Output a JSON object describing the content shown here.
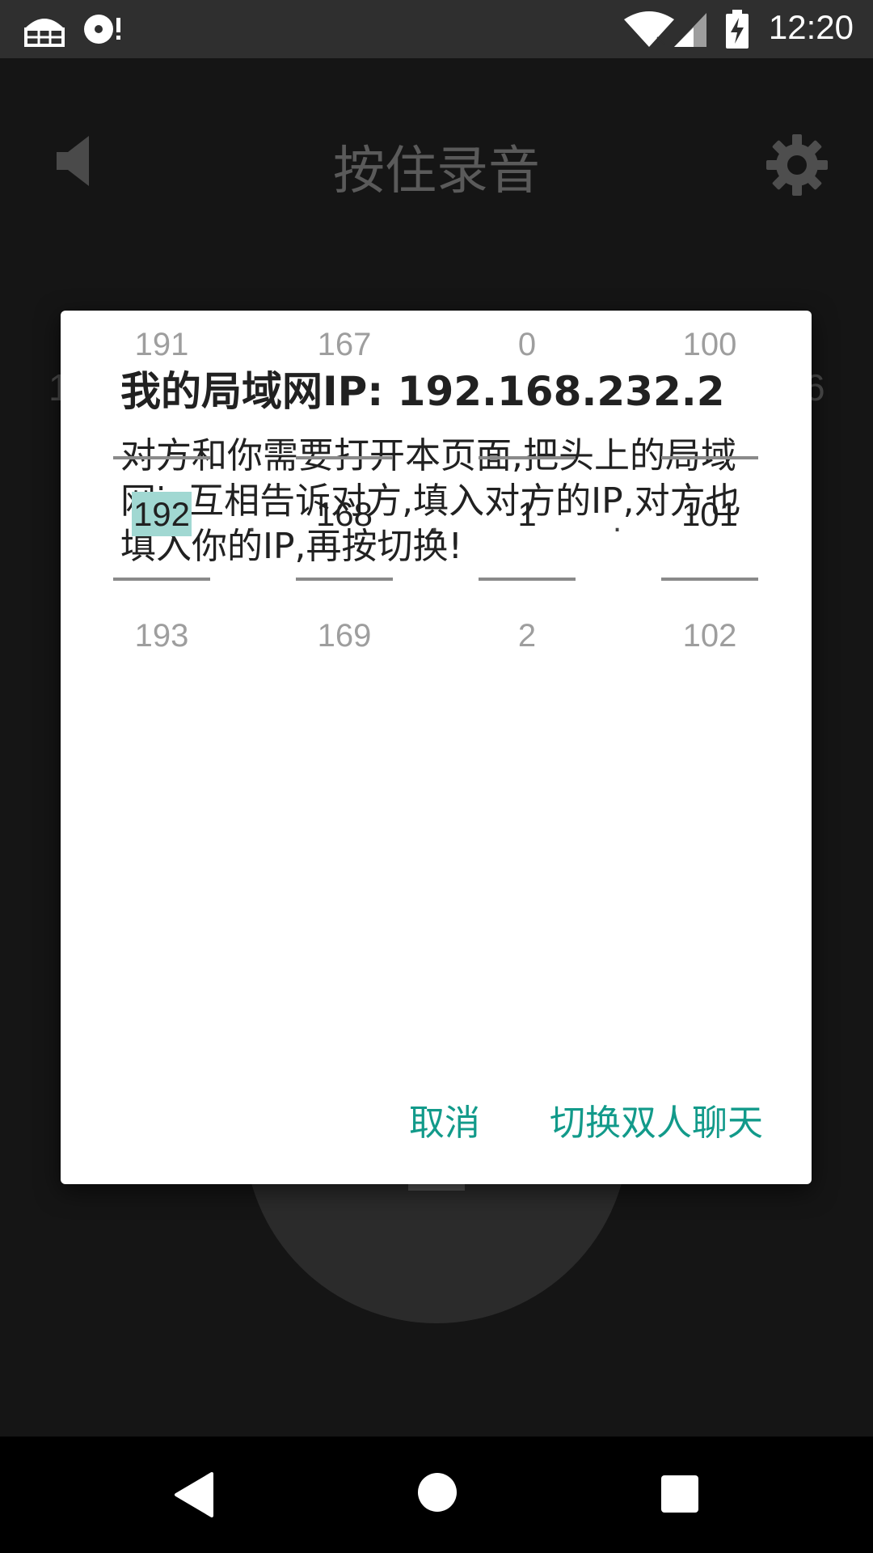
{
  "status_bar": {
    "time": "12:20",
    "icons": [
      "shop-icon",
      "disc-alert-icon",
      "wifi-icon",
      "signal-icon",
      "battery-charging-icon"
    ]
  },
  "app": {
    "title": "按住录音",
    "left_partial_number": "1",
    "right_partial_number": "6"
  },
  "dialog": {
    "title": "我的局域网IP: 192.168.232.2",
    "message": "对方和你需要打开本页面,把头上的局域网ip互相告诉对方,填入对方的IP,对方也填入你的IP,再按切换!",
    "pickers": [
      {
        "prev": "191",
        "current": "192",
        "next": "193"
      },
      {
        "prev": "167",
        "current": "168",
        "next": "169"
      },
      {
        "prev": "0",
        "current": "1",
        "next": "2"
      },
      {
        "prev": "100",
        "current": "101",
        "next": "102"
      }
    ],
    "separator": ".",
    "cancel_label": "取消",
    "confirm_label": "切换双人聊天",
    "accent_color": "#129a8a",
    "highlight_color": "#a1d8d2"
  },
  "nav_bar": {
    "icons": [
      "back-icon",
      "home-icon",
      "recents-icon"
    ]
  }
}
